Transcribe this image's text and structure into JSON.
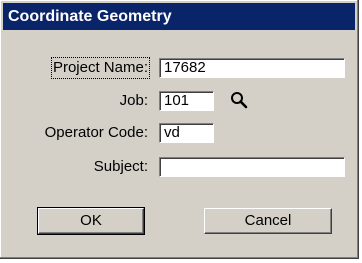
{
  "window": {
    "title": "Coordinate Geometry"
  },
  "form": {
    "project_name": {
      "label": "Project Name:",
      "value": "17682"
    },
    "job": {
      "label": "Job:",
      "value": "101"
    },
    "operator_code": {
      "label": "Operator Code:",
      "value": "vd"
    },
    "subject": {
      "label": "Subject:",
      "value": ""
    }
  },
  "buttons": {
    "ok_label": "OK",
    "cancel_label": "Cancel"
  },
  "icons": {
    "job_lookup": "magnifier-icon"
  },
  "colors": {
    "titlebar": "#0a246a",
    "face": "#d4d0c8"
  }
}
